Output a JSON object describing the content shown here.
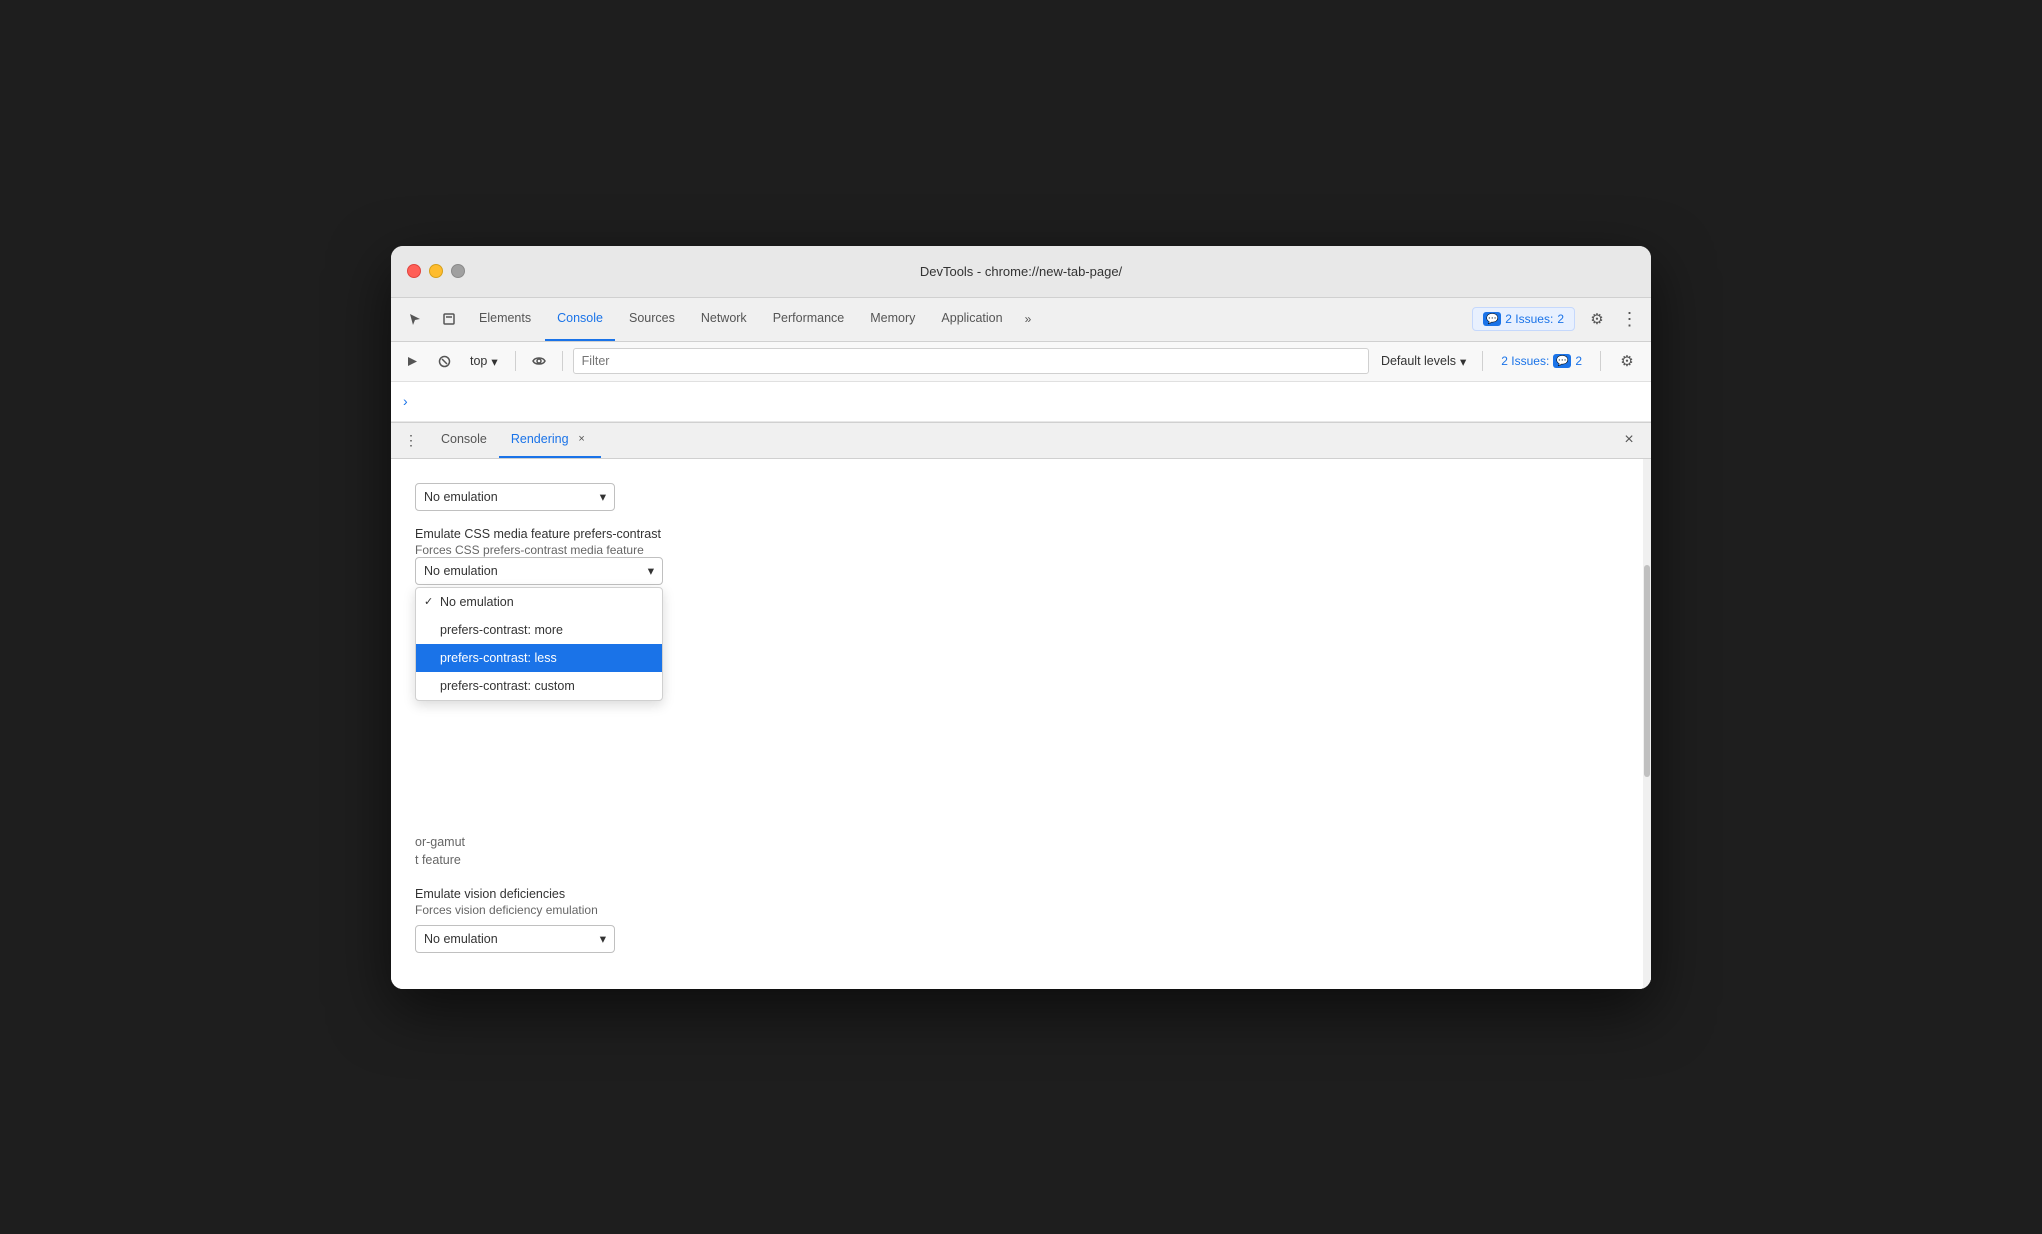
{
  "window": {
    "title": "DevTools - chrome://new-tab-page/"
  },
  "tabs": {
    "items": [
      {
        "label": "Elements",
        "active": false
      },
      {
        "label": "Console",
        "active": true
      },
      {
        "label": "Sources",
        "active": false
      },
      {
        "label": "Network",
        "active": false
      },
      {
        "label": "Performance",
        "active": false
      },
      {
        "label": "Memory",
        "active": false
      },
      {
        "label": "Application",
        "active": false
      }
    ],
    "more_label": "»",
    "issues_count": "2",
    "issues_label": "2 Issues:"
  },
  "console_toolbar": {
    "top_label": "top",
    "filter_placeholder": "Filter",
    "default_levels_label": "Default levels",
    "issues_label": "2 Issues:",
    "issues_count": "2"
  },
  "drawer": {
    "console_tab": "Console",
    "rendering_tab": "Rendering",
    "close_label": "×"
  },
  "rendering": {
    "first_dropdown_value": "No emulation",
    "section_label": "Emulate CSS media feature prefers-contrast",
    "section_sublabel": "Forces CSS prefers-contrast media feature",
    "current_value": "No emulation",
    "dropdown_options": [
      {
        "value": "No emulation",
        "selected": true,
        "checked": true
      },
      {
        "value": "prefers-contrast: more",
        "selected": false,
        "checked": false
      },
      {
        "value": "prefers-contrast: less",
        "selected": true,
        "highlighted": true,
        "checked": false
      },
      {
        "value": "prefers-contrast: custom",
        "selected": false,
        "checked": false
      }
    ],
    "background_partial1": "or-gamut",
    "background_partial2": "t feature",
    "vision_label": "Emulate vision deficiencies",
    "vision_sublabel": "Forces vision deficiency emulation",
    "vision_dropdown_value": "No emulation"
  },
  "icons": {
    "cursor": "⬚",
    "layers": "⧉",
    "play": "▶",
    "ban": "⊘",
    "eye": "◉",
    "chevron_down": "▾",
    "chevron_right": "›",
    "gear": "⚙",
    "kebab": "⋮",
    "message": "💬"
  }
}
